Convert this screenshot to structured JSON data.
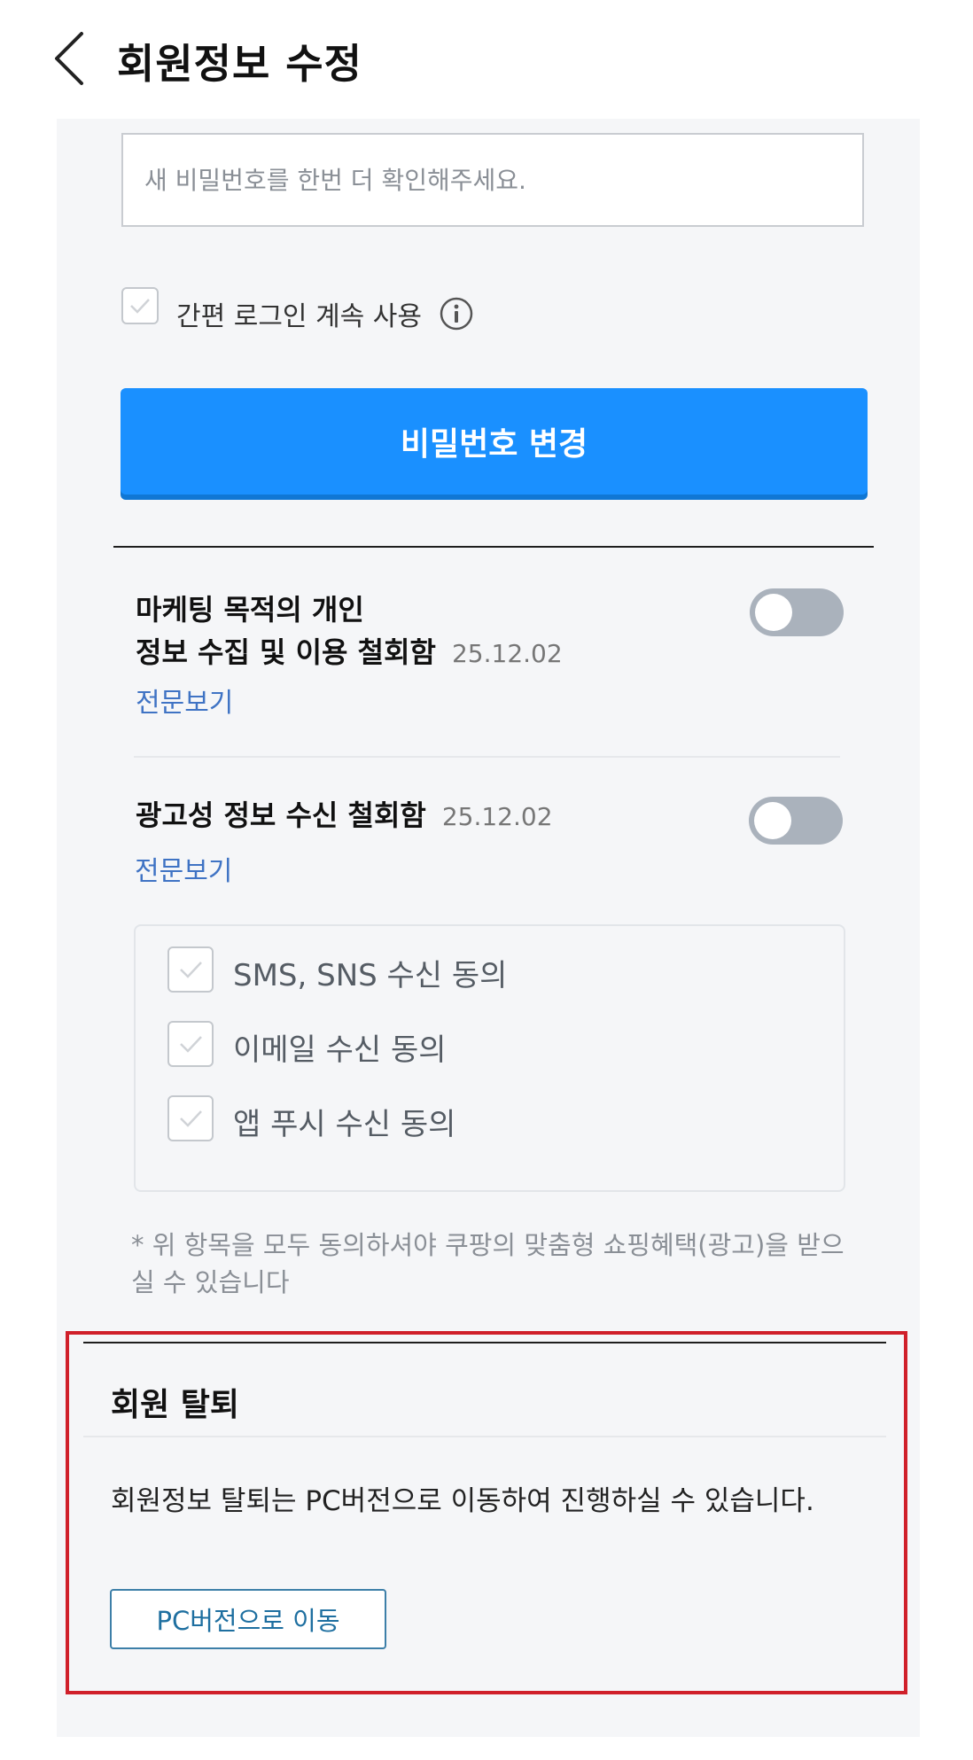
{
  "header": {
    "title": "회원정보 수정",
    "back_icon": "chevron-left-icon"
  },
  "password": {
    "confirm_placeholder": "새 비밀번호를 한번 더 확인해주세요.",
    "easy_login_label": "간편 로그인 계속 사용",
    "easy_login_checked": false,
    "change_button": "비밀번호 변경"
  },
  "marketing": {
    "title_line1": "마케팅 목적의 개인",
    "title_line2": "정보 수집 및 이용 철회함",
    "date": "25.12.02",
    "link": "전문보기",
    "toggle_on": false
  },
  "ads": {
    "title": "광고성 정보 수신 철회함",
    "date": "25.12.02",
    "link": "전문보기",
    "toggle_on": false,
    "consents": [
      {
        "label": "SMS, SNS 수신 동의",
        "checked": false
      },
      {
        "label": "이메일 수신 동의",
        "checked": false
      },
      {
        "label": "앱 푸시 수신 동의",
        "checked": false
      }
    ],
    "note": "* 위 항목을 모두 동의하셔야 쿠팡의 맞춤형 쇼핑혜택(광고)을 받으실 수 있습니다"
  },
  "withdraw": {
    "title": "회원 탈퇴",
    "description": "회원정보 탈퇴는 PC버전으로 이동하여 진행하실 수 있습니다.",
    "button": "PC버전으로 이동"
  },
  "colors": {
    "primary": "#1a90ff",
    "link": "#3f73c4",
    "highlight": "#d0202a",
    "toggle_off": "#aab2bc"
  }
}
